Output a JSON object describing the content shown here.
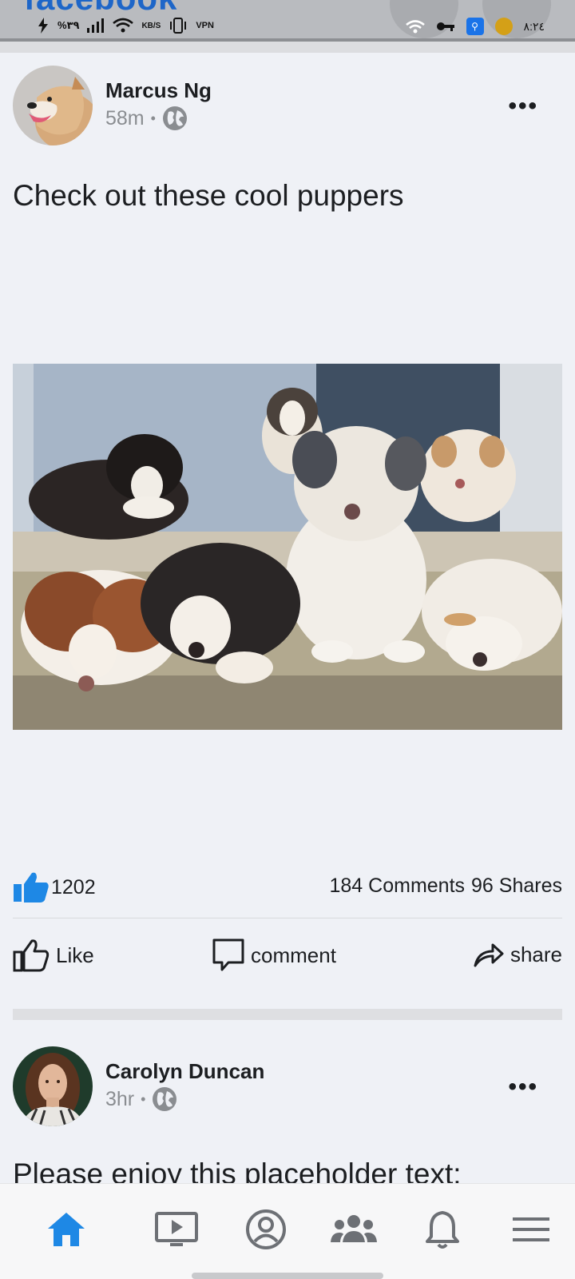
{
  "status_bar": {
    "app_peek": "facebook",
    "battery": "%٣٩",
    "net_speed": "KB/S",
    "vpn": "VPN",
    "time": "٨:٢٤"
  },
  "posts": [
    {
      "author": "Marcus Ng",
      "time": "58m",
      "separator": "•",
      "text": "Check out these cool puppers",
      "likes": "1202",
      "comments": "184 Comments",
      "shares": "96 Shares",
      "actions": {
        "like": "Like",
        "comment": "comment",
        "share": "share"
      }
    },
    {
      "author": "Carolyn Duncan",
      "time": "3hr",
      "separator": "•",
      "text": "Please enjoy this placeholder text:"
    }
  ],
  "colors": {
    "accent": "#1e88e5",
    "background": "#eff1f6",
    "text": "#1c1e21",
    "muted": "#8a8d91"
  },
  "nav": [
    "home-icon",
    "video-icon",
    "profile-icon",
    "groups-icon",
    "notifications-icon",
    "menu-icon"
  ]
}
